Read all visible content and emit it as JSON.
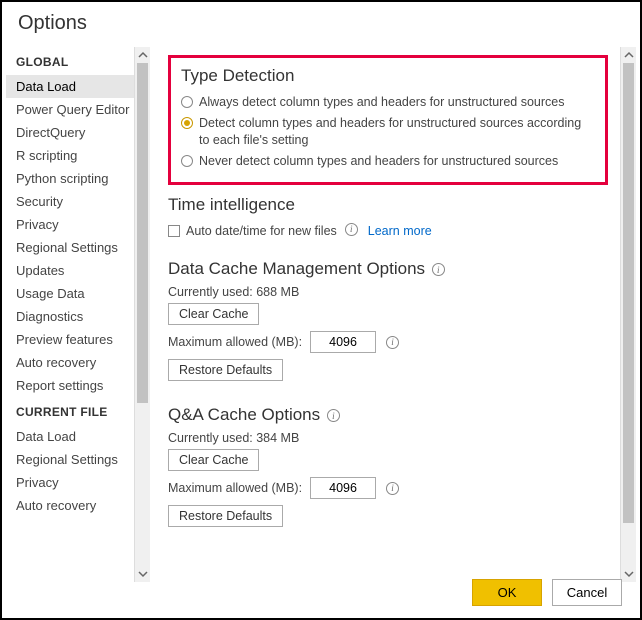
{
  "window": {
    "title": "Options"
  },
  "sidebar": {
    "sections": [
      {
        "header": "GLOBAL",
        "items": [
          {
            "label": "Data Load",
            "selected": true
          },
          {
            "label": "Power Query Editor"
          },
          {
            "label": "DirectQuery"
          },
          {
            "label": "R scripting"
          },
          {
            "label": "Python scripting"
          },
          {
            "label": "Security"
          },
          {
            "label": "Privacy"
          },
          {
            "label": "Regional Settings"
          },
          {
            "label": "Updates"
          },
          {
            "label": "Usage Data"
          },
          {
            "label": "Diagnostics"
          },
          {
            "label": "Preview features"
          },
          {
            "label": "Auto recovery"
          },
          {
            "label": "Report settings"
          }
        ]
      },
      {
        "header": "CURRENT FILE",
        "items": [
          {
            "label": "Data Load"
          },
          {
            "label": "Regional Settings"
          },
          {
            "label": "Privacy"
          },
          {
            "label": "Auto recovery"
          }
        ]
      }
    ]
  },
  "content": {
    "type_detection": {
      "title": "Type Detection",
      "options": [
        "Always detect column types and headers for unstructured sources",
        "Detect column types and headers for unstructured sources according to each file's setting",
        "Never detect column types and headers for unstructured sources"
      ],
      "selected": 1
    },
    "time_intel": {
      "title": "Time intelligence",
      "checkbox": "Auto date/time for new files",
      "link": "Learn more"
    },
    "data_cache": {
      "title": "Data Cache Management Options",
      "used_label": "Currently used: 688 MB",
      "clear_btn": "Clear Cache",
      "max_label": "Maximum allowed (MB):",
      "max_value": "4096",
      "restore_btn": "Restore Defaults"
    },
    "qa_cache": {
      "title": "Q&A Cache Options",
      "used_label": "Currently used: 384 MB",
      "clear_btn": "Clear Cache",
      "max_label": "Maximum allowed (MB):",
      "max_value": "4096",
      "restore_btn": "Restore Defaults"
    }
  },
  "footer": {
    "ok": "OK",
    "cancel": "Cancel"
  }
}
